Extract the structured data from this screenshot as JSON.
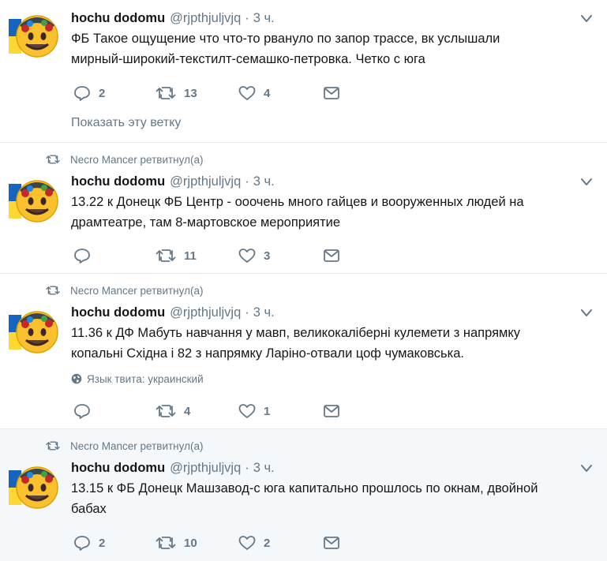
{
  "colors": {
    "text": "#14171a",
    "muted": "#657786",
    "divider": "#e6ecf0",
    "hover_bg": "#f5f8fa"
  },
  "retweet_label": "Necro Mancer ретвитнул(а)",
  "show_thread_label": "Показать эту ветку",
  "lang_label": "Язык твита: украинский",
  "tweets": [
    {
      "author_name": "hochu dodomu",
      "author_handle": "@rjpthjuljvjq",
      "separator": "·",
      "time": "3 ч.",
      "text_lines": [
        "ФБ Такое ощущение что что-то рвануло по запор трассе, вк услышали",
        "мирный-широкий-текстилт-семашко-петровка. Четко с юга"
      ],
      "replies": "2",
      "retweets": "13",
      "likes": "4"
    },
    {
      "author_name": "hochu dodomu",
      "author_handle": "@rjpthjuljvjq",
      "separator": "·",
      "time": "3 ч.",
      "text_lines": [
        "13.22 к Донецк ФБ Центр - ооочень много гайцев и вооруженных людей на",
        "драмтеатре, там 8-мартовское мероприятие"
      ],
      "replies": "",
      "retweets": "11",
      "likes": "3"
    },
    {
      "author_name": "hochu dodomu",
      "author_handle": "@rjpthjuljvjq",
      "separator": "·",
      "time": "3 ч.",
      "text_lines": [
        "11.36 к ДФ Мабуть навчання у мавп, великокаліберні кулемети з напрямку",
        "копальні Східна і 82 з напрямку Ларіно-отвали цоф чумаковська."
      ],
      "replies": "",
      "retweets": "4",
      "likes": "1"
    },
    {
      "author_name": "hochu dodomu",
      "author_handle": "@rjpthjuljvjq",
      "separator": "·",
      "time": "3 ч.",
      "text_lines": [
        "13.15 к ФБ Донецк Машзавод-с юга капитально прошлось по окнам, двойной",
        "бабах"
      ],
      "replies": "2",
      "retweets": "10",
      "likes": "2"
    }
  ]
}
